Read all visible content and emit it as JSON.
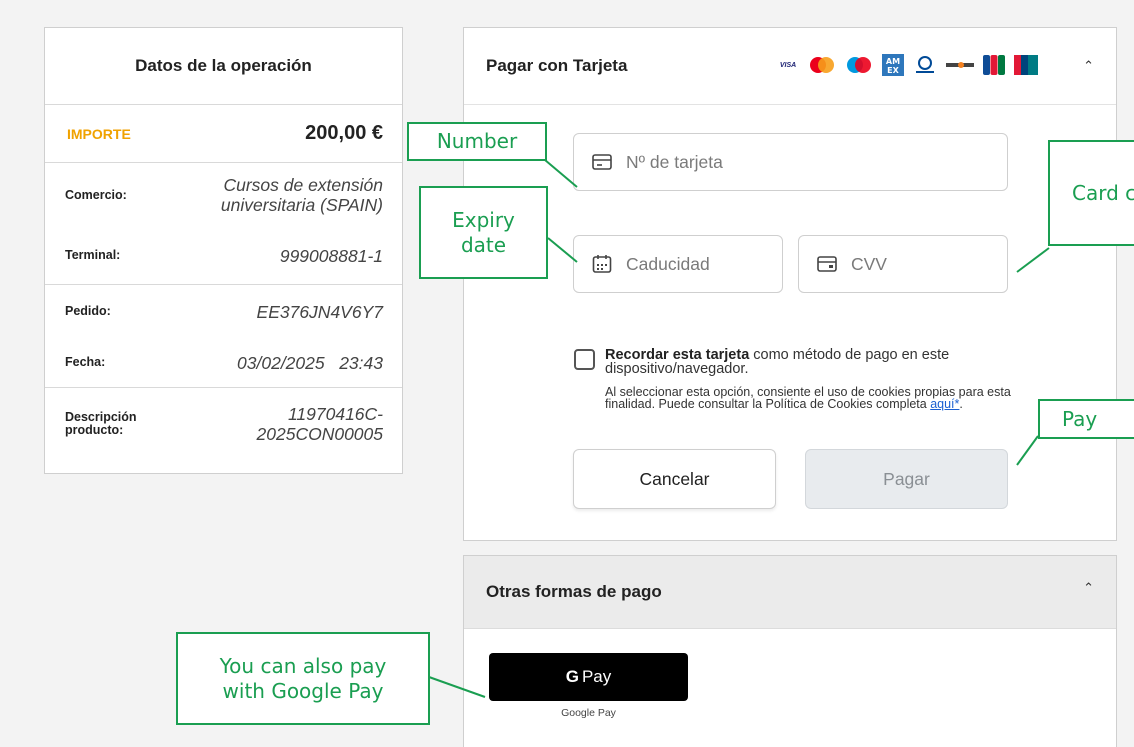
{
  "summary": {
    "title": "Datos de la operación",
    "amount_label": "IMPORTE",
    "amount_value": "200,00 €",
    "rows": [
      {
        "label": "Comercio:",
        "value": "Cursos de extensión universitaria (SPAIN)"
      },
      {
        "label": "Terminal:",
        "value": "999008881-1"
      },
      {
        "label": "Pedido:",
        "value": "EE376JN4V6Y7"
      },
      {
        "label": "Fecha:",
        "value": "03/02/2025   23:43"
      },
      {
        "label": "Descripción producto:",
        "value": "11970416C-2025CON00005"
      }
    ]
  },
  "card": {
    "title": "Pagar con Tarjeta",
    "brands": [
      "visa-icon",
      "mastercard-icon",
      "maestro-icon",
      "amex-icon",
      "diners-icon",
      "discover-icon",
      "jcb-icon",
      "unionpay-icon"
    ],
    "number_placeholder": "Nº de tarjeta",
    "expiry_placeholder": "Caducidad",
    "cvv_placeholder": "CVV",
    "remember_bold": "Recordar esta tarjeta",
    "remember_rest": " como método de pago en este dispositivo/navegador.",
    "cookie_text": "Al seleccionar esta opción, consiente el uso de cookies propias para esta finalidad. Puede consultar la Política de Cookies completa ",
    "cookie_link": "aquí*",
    "cookie_end": ".",
    "cancel_label": "Cancelar",
    "pay_label": "Pagar"
  },
  "other": {
    "title": "Otras formas de pago",
    "gpay_g": "G",
    "gpay_label": "Pay",
    "gpay_caption": "Google Pay"
  },
  "annotations": {
    "number": "Number",
    "expiry": "Expiry date",
    "card_code": "Card c",
    "pay": "Pay",
    "google_pay": "You can also pay with Google Pay"
  },
  "colors": {
    "accent_orange": "#f0a200",
    "callout_green": "#1a9e51",
    "link_blue": "#1a5fd1"
  }
}
